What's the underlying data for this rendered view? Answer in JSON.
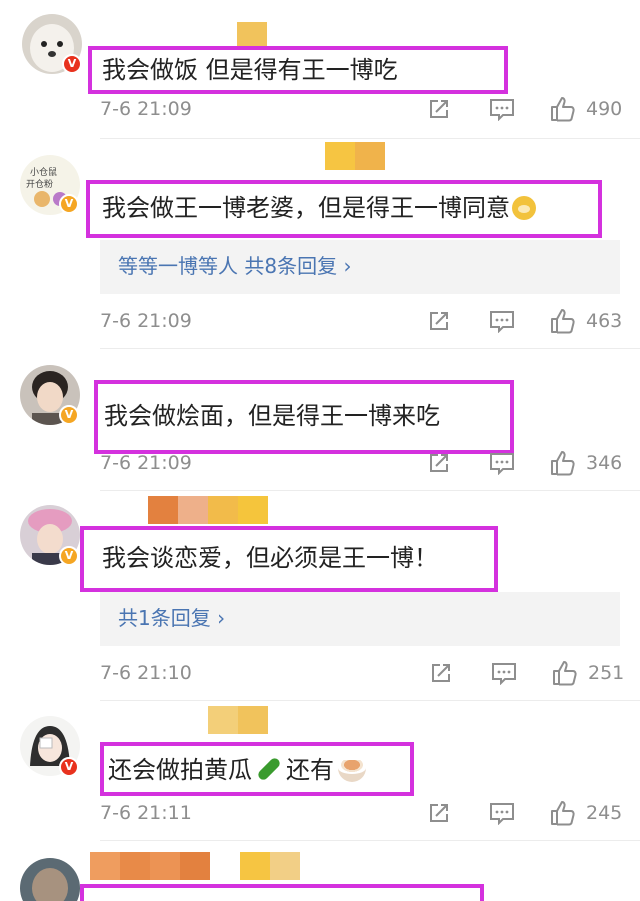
{
  "comments": [
    {
      "avatar": "dog-avatar",
      "badge": "V",
      "text": "我会做饭 但是得有王一博吃",
      "time": "7-6 21:09",
      "likes": "490",
      "replies": ""
    },
    {
      "avatar": "cartoon-hamster-avatar",
      "badge": "V",
      "text": "我会做王一博老婆，但是得王一博同意",
      "emoji": "doge-emoji",
      "replies": "等等一博等人  共8条回复 ›",
      "time": "7-6 21:09",
      "likes": "463"
    },
    {
      "avatar": "person-avatar",
      "badge": "V",
      "text": "我会做烩面，但是得王一博来吃",
      "time": "7-6 21:09",
      "likes": "346",
      "replies": ""
    },
    {
      "avatar": "person-pink-hat-avatar",
      "badge": "V",
      "text": "我会谈恋爱，但必须是王一博！",
      "replies": "共1条回复 ›",
      "time": "7-6 21:10",
      "likes": "251"
    },
    {
      "avatar": "drawn-girl-avatar",
      "badge": "V",
      "text_part1": "还会做拍黄瓜",
      "text_part2": "还有",
      "emojis": [
        "cucumber-emoji",
        "noodle-bowl-emoji"
      ],
      "time": "7-6 21:11",
      "likes": "245",
      "replies": ""
    }
  ],
  "colors": {
    "highlight_border": "#d431de",
    "reply_link": "#4a75b2",
    "meta_gray": "#8e8e8e",
    "badge_orange": "#f5a623",
    "badge_red": "#e8321e"
  }
}
